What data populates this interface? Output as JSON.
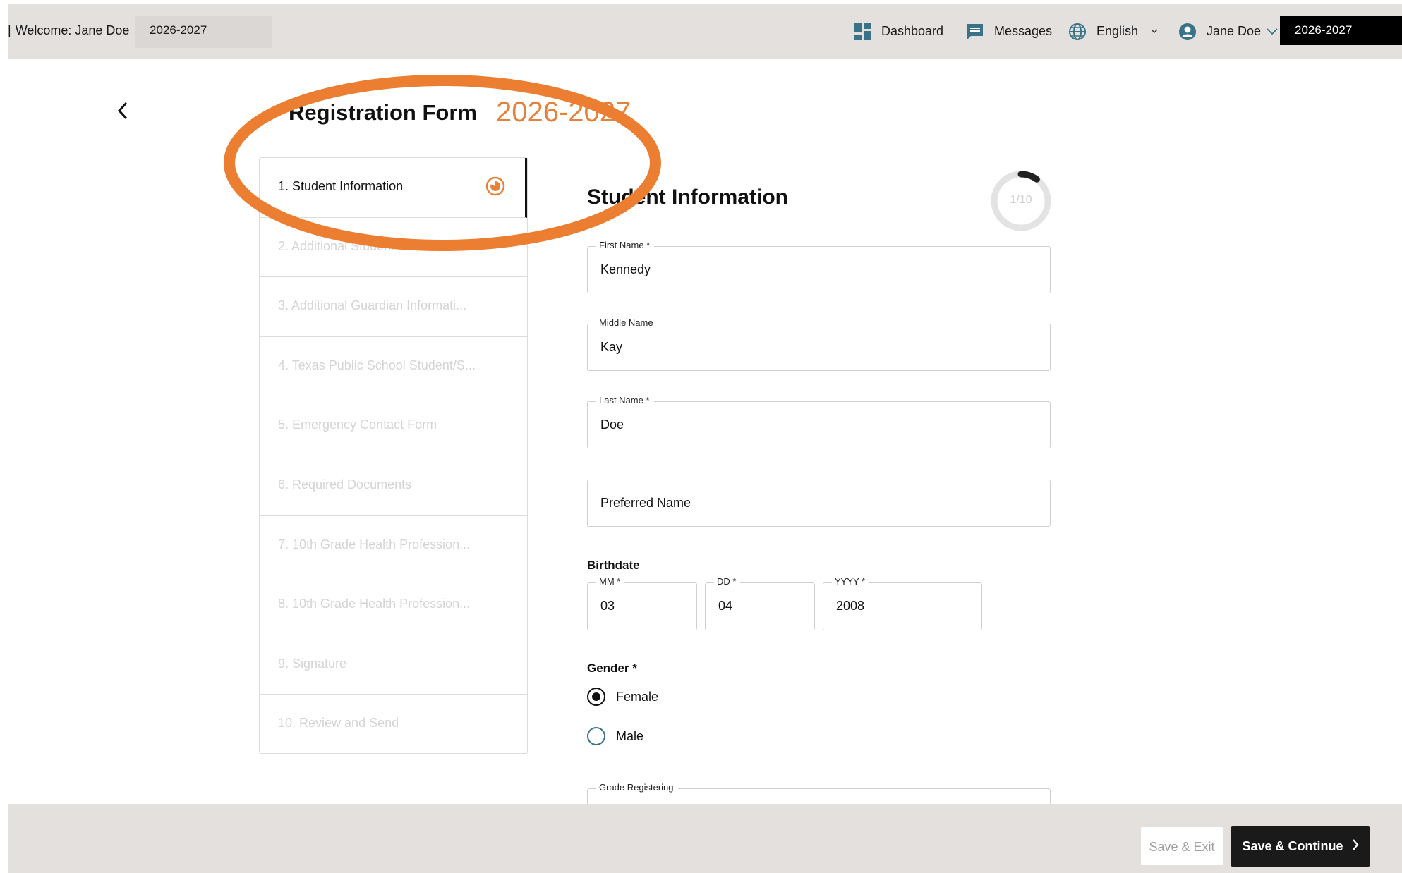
{
  "topbar": {
    "welcome": "Welcome: Jane Doe",
    "year_chip": "2026-2027",
    "dashboard": "Dashboard",
    "messages": "Messages",
    "language": "English",
    "user": "Jane Doe",
    "year_black": "2026-2027"
  },
  "header": {
    "title": "Registration Form",
    "year": "2026-2027"
  },
  "steps": [
    {
      "label": "1. Student Information",
      "state": "active"
    },
    {
      "label": "2. Additional Student Information",
      "state": "disabled"
    },
    {
      "label": "3. Additional Guardian Informati...",
      "state": "disabled"
    },
    {
      "label": "4. Texas Public School Student/S...",
      "state": "disabled"
    },
    {
      "label": "5. Emergency Contact Form",
      "state": "disabled"
    },
    {
      "label": "6. Required Documents",
      "state": "disabled"
    },
    {
      "label": "7. 10th Grade Health Profession...",
      "state": "disabled"
    },
    {
      "label": "8. 10th Grade Health Profession...",
      "state": "disabled"
    },
    {
      "label": "9. Signature",
      "state": "disabled"
    },
    {
      "label": "10. Review and Send",
      "state": "disabled"
    }
  ],
  "form": {
    "section_title": "Student Information",
    "progress_text": "1/10",
    "progress_fraction": 0.1,
    "first_name": {
      "label": "First Name *",
      "value": "Kennedy"
    },
    "middle_name": {
      "label": "Middle Name",
      "value": "Kay"
    },
    "last_name": {
      "label": "Last Name *",
      "value": "Doe"
    },
    "preferred_name": {
      "placeholder": "Preferred Name"
    },
    "birthdate_label": "Birthdate",
    "mm": {
      "label": "MM *",
      "value": "03"
    },
    "dd": {
      "label": "DD *",
      "value": "04"
    },
    "yyyy": {
      "label": "YYYY *",
      "value": "2008"
    },
    "gender_label": "Gender *",
    "gender_options": [
      "Female",
      "Male"
    ],
    "gender_selected": "Female",
    "grade_label": "Grade Registering"
  },
  "footer": {
    "save_exit": "Save & Exit",
    "save_continue": "Save & Continue"
  },
  "colors": {
    "accent_orange": "#e5823a",
    "topbar_bg": "#e4e0dd",
    "icon_blue": "#3a7387"
  }
}
